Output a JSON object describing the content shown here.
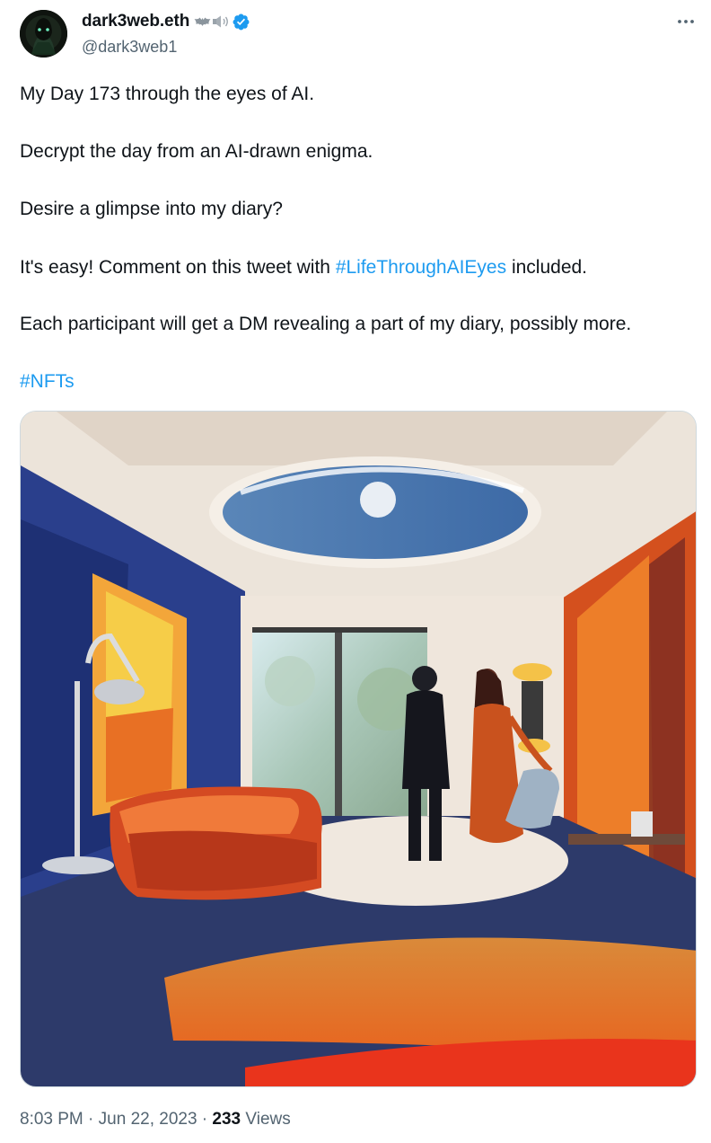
{
  "author": {
    "display_name": "dark3web.eth",
    "handle": "@dark3web1",
    "name_emojis": [
      "bat-emoji",
      "speaker-emoji"
    ],
    "verified": true,
    "verified_color": "#1d9bf0"
  },
  "tweet": {
    "line1": "My Day 173 through the eyes of AI.",
    "line2": "Decrypt the day from an AI-drawn enigma.",
    "line3": "Desire a glimpse into my diary?",
    "line4_before": "It's easy! Comment on this tweet with ",
    "line4_hashtag": "#LifeThroughAIEyes",
    "line4_after": " included.",
    "line5": "Each participant will get a DM revealing a part of my diary, possibly more.",
    "line6_hashtag": "#NFTs",
    "hashtag_color": "#1d9bf0"
  },
  "media": {
    "type": "image",
    "icon": "painting-image"
  },
  "meta": {
    "time": "8:03 PM",
    "separator": " · ",
    "date": "Jun 22, 2023",
    "views_count": "233",
    "views_label": "Views"
  },
  "more_icon": "more-horizontal-icon"
}
